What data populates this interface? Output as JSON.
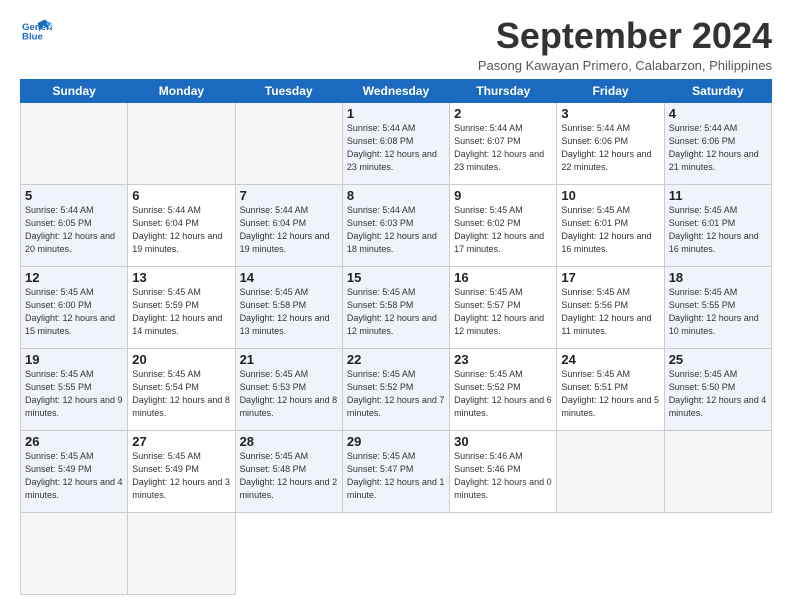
{
  "header": {
    "logo_line1": "General",
    "logo_line2": "Blue",
    "month_title": "September 2024",
    "location": "Pasong Kawayan Primero, Calabarzon, Philippines"
  },
  "weekdays": [
    "Sunday",
    "Monday",
    "Tuesday",
    "Wednesday",
    "Thursday",
    "Friday",
    "Saturday"
  ],
  "days": [
    {
      "day": "",
      "info": "",
      "empty": true
    },
    {
      "day": "",
      "info": "",
      "empty": true
    },
    {
      "day": "",
      "info": "",
      "empty": true
    },
    {
      "day": "1",
      "info": "Sunrise: 5:44 AM\nSunset: 6:08 PM\nDaylight: 12 hours\nand 23 minutes.",
      "weekend": true
    },
    {
      "day": "2",
      "info": "Sunrise: 5:44 AM\nSunset: 6:07 PM\nDaylight: 12 hours\nand 23 minutes."
    },
    {
      "day": "3",
      "info": "Sunrise: 5:44 AM\nSunset: 6:06 PM\nDaylight: 12 hours\nand 22 minutes."
    },
    {
      "day": "4",
      "info": "Sunrise: 5:44 AM\nSunset: 6:06 PM\nDaylight: 12 hours\nand 21 minutes."
    },
    {
      "day": "5",
      "info": "Sunrise: 5:44 AM\nSunset: 6:05 PM\nDaylight: 12 hours\nand 20 minutes."
    },
    {
      "day": "6",
      "info": "Sunrise: 5:44 AM\nSunset: 6:04 PM\nDaylight: 12 hours\nand 19 minutes."
    },
    {
      "day": "7",
      "info": "Sunrise: 5:44 AM\nSunset: 6:04 PM\nDaylight: 12 hours\nand 19 minutes.",
      "weekend": true
    },
    {
      "day": "8",
      "info": "Sunrise: 5:44 AM\nSunset: 6:03 PM\nDaylight: 12 hours\nand 18 minutes.",
      "weekend": true
    },
    {
      "day": "9",
      "info": "Sunrise: 5:45 AM\nSunset: 6:02 PM\nDaylight: 12 hours\nand 17 minutes."
    },
    {
      "day": "10",
      "info": "Sunrise: 5:45 AM\nSunset: 6:01 PM\nDaylight: 12 hours\nand 16 minutes."
    },
    {
      "day": "11",
      "info": "Sunrise: 5:45 AM\nSunset: 6:01 PM\nDaylight: 12 hours\nand 16 minutes."
    },
    {
      "day": "12",
      "info": "Sunrise: 5:45 AM\nSunset: 6:00 PM\nDaylight: 12 hours\nand 15 minutes."
    },
    {
      "day": "13",
      "info": "Sunrise: 5:45 AM\nSunset: 5:59 PM\nDaylight: 12 hours\nand 14 minutes."
    },
    {
      "day": "14",
      "info": "Sunrise: 5:45 AM\nSunset: 5:58 PM\nDaylight: 12 hours\nand 13 minutes.",
      "weekend": true
    },
    {
      "day": "15",
      "info": "Sunrise: 5:45 AM\nSunset: 5:58 PM\nDaylight: 12 hours\nand 12 minutes.",
      "weekend": true
    },
    {
      "day": "16",
      "info": "Sunrise: 5:45 AM\nSunset: 5:57 PM\nDaylight: 12 hours\nand 12 minutes."
    },
    {
      "day": "17",
      "info": "Sunrise: 5:45 AM\nSunset: 5:56 PM\nDaylight: 12 hours\nand 11 minutes."
    },
    {
      "day": "18",
      "info": "Sunrise: 5:45 AM\nSunset: 5:55 PM\nDaylight: 12 hours\nand 10 minutes."
    },
    {
      "day": "19",
      "info": "Sunrise: 5:45 AM\nSunset: 5:55 PM\nDaylight: 12 hours\nand 9 minutes."
    },
    {
      "day": "20",
      "info": "Sunrise: 5:45 AM\nSunset: 5:54 PM\nDaylight: 12 hours\nand 8 minutes."
    },
    {
      "day": "21",
      "info": "Sunrise: 5:45 AM\nSunset: 5:53 PM\nDaylight: 12 hours\nand 8 minutes.",
      "weekend": true
    },
    {
      "day": "22",
      "info": "Sunrise: 5:45 AM\nSunset: 5:52 PM\nDaylight: 12 hours\nand 7 minutes.",
      "weekend": true
    },
    {
      "day": "23",
      "info": "Sunrise: 5:45 AM\nSunset: 5:52 PM\nDaylight: 12 hours\nand 6 minutes."
    },
    {
      "day": "24",
      "info": "Sunrise: 5:45 AM\nSunset: 5:51 PM\nDaylight: 12 hours\nand 5 minutes."
    },
    {
      "day": "25",
      "info": "Sunrise: 5:45 AM\nSunset: 5:50 PM\nDaylight: 12 hours\nand 4 minutes."
    },
    {
      "day": "26",
      "info": "Sunrise: 5:45 AM\nSunset: 5:49 PM\nDaylight: 12 hours\nand 4 minutes."
    },
    {
      "day": "27",
      "info": "Sunrise: 5:45 AM\nSunset: 5:49 PM\nDaylight: 12 hours\nand 3 minutes."
    },
    {
      "day": "28",
      "info": "Sunrise: 5:45 AM\nSunset: 5:48 PM\nDaylight: 12 hours\nand 2 minutes.",
      "weekend": true
    },
    {
      "day": "29",
      "info": "Sunrise: 5:45 AM\nSunset: 5:47 PM\nDaylight: 12 hours\nand 1 minute.",
      "weekend": true
    },
    {
      "day": "30",
      "info": "Sunrise: 5:46 AM\nSunset: 5:46 PM\nDaylight: 12 hours\nand 0 minutes."
    },
    {
      "day": "",
      "info": "",
      "empty": true
    },
    {
      "day": "",
      "info": "",
      "empty": true
    },
    {
      "day": "",
      "info": "",
      "empty": true
    },
    {
      "day": "",
      "info": "",
      "empty": true
    }
  ]
}
